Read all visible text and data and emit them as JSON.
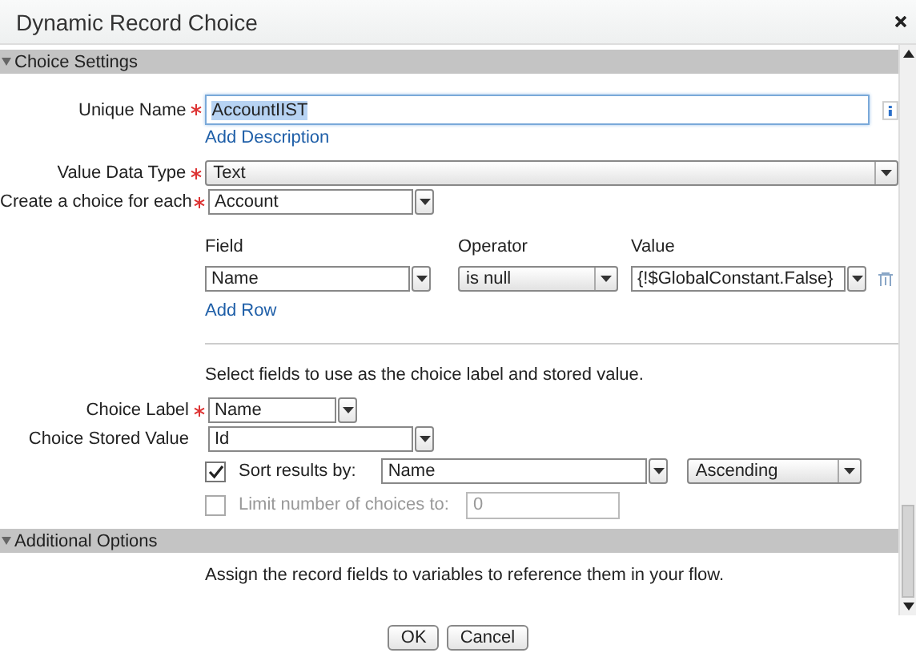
{
  "window": {
    "title": "Dynamic Record Choice"
  },
  "choice_settings": {
    "title": "Choice Settings",
    "expanded": true,
    "unique_name": {
      "label": "Unique Name",
      "required": true,
      "value": "AccountIIST",
      "focused": true,
      "text_selected": true
    },
    "add_description": "Add Description",
    "value_data_type": {
      "label": "Value Data Type",
      "required": true,
      "kind": "picklist",
      "value": "Text"
    },
    "create_choice_for_each": {
      "label": "Create a choice for each",
      "required": true,
      "kind": "combobox",
      "value": "Account"
    },
    "filter": {
      "columns": [
        "Field",
        "Operator",
        "Value"
      ],
      "rows": [
        {
          "field": {
            "kind": "combobox",
            "value": "Name"
          },
          "operator": {
            "kind": "picklist",
            "value": "is null"
          },
          "value": {
            "kind": "combobox",
            "value": "{!$GlobalConstant.False}"
          }
        }
      ],
      "add_row": "Add Row"
    },
    "hint": "Select fields to use as the choice label and stored value.",
    "choice_label": {
      "label": "Choice Label",
      "required": true,
      "kind": "combobox",
      "value": "Name"
    },
    "choice_stored_value": {
      "label": "Choice Stored Value",
      "kind": "combobox",
      "value": "Id"
    },
    "sort": {
      "label": "Sort results by:",
      "checked": true,
      "disabled": false,
      "field": {
        "kind": "combobox",
        "value": "Name"
      },
      "order": {
        "kind": "picklist",
        "value": "Ascending"
      }
    },
    "limit": {
      "label": "Limit number of choices to:",
      "checked": false,
      "disabled": true,
      "value": "0"
    }
  },
  "additional_options": {
    "title": "Additional Options",
    "expanded": true,
    "text": "Assign the record fields to variables to reference them in your flow."
  },
  "buttons": [
    "OK",
    "Cancel"
  ]
}
